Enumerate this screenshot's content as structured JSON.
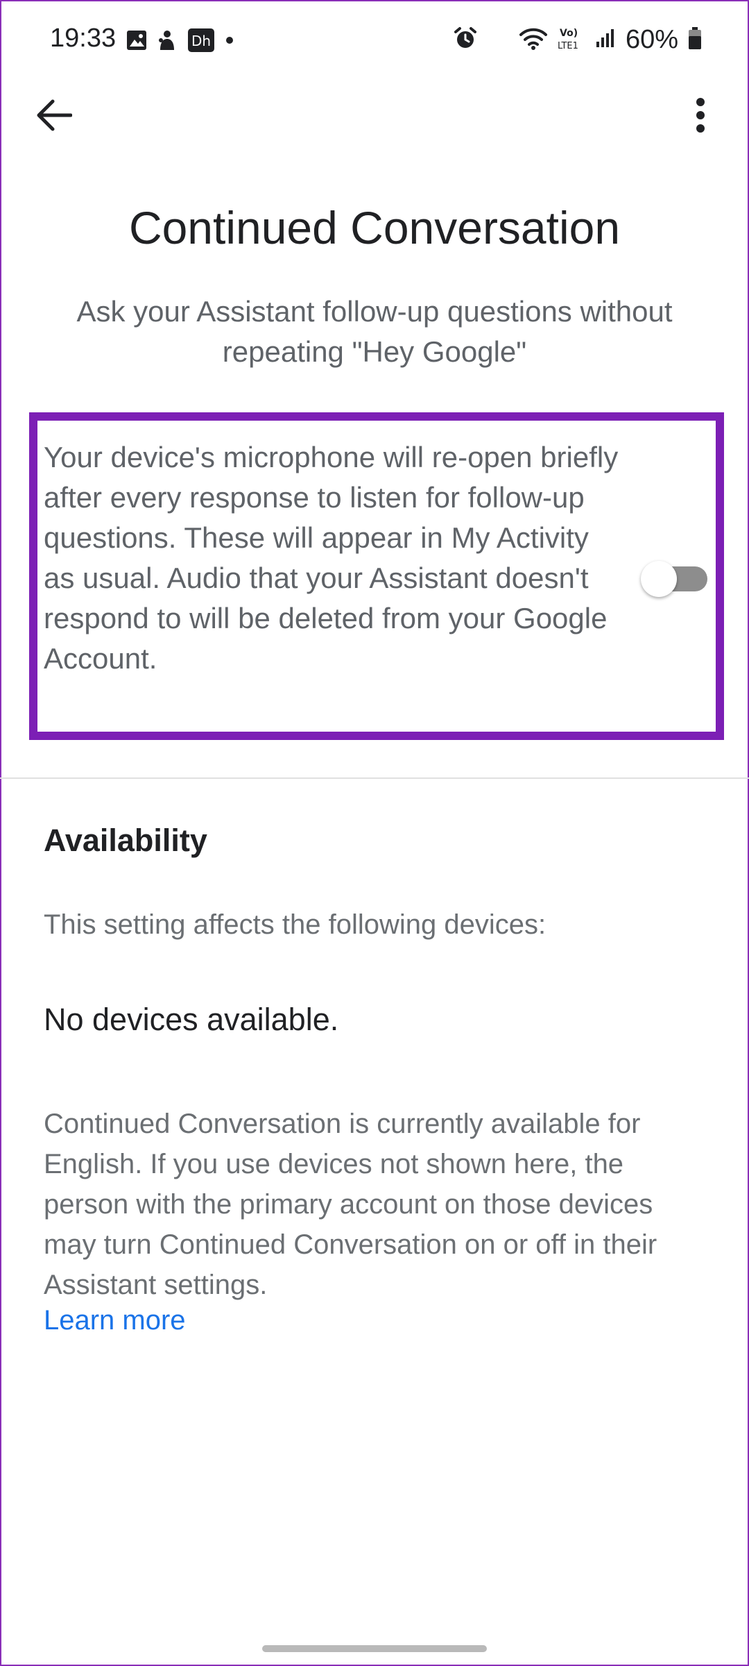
{
  "status_bar": {
    "time": "19:33",
    "battery_percent": "60%",
    "left_icons": [
      "gallery-icon",
      "teams-icon",
      "disney-hotstar-icon",
      "dot-icon"
    ],
    "right_icons": [
      "alarm-icon",
      "wifi-icon",
      "volte-lte-icon",
      "signal-icon",
      "battery-icon"
    ],
    "volte_label": "Vo)",
    "lte_label": "LTE1"
  },
  "app_bar": {
    "back_icon": "arrow-back-icon",
    "more_icon": "more-vert-icon"
  },
  "header": {
    "title": "Continued Conversation",
    "subtitle": "Ask your Assistant follow-up questions without repeating \"Hey Google\""
  },
  "setting": {
    "description": "Your device's microphone will re-open briefly after every response to listen for follow-up questions. These will appear in My Activity as usual. Audio that your Assistant doesn't respond to will be deleted from your Google Account.",
    "toggle_on": false
  },
  "availability": {
    "heading": "Availability",
    "caption": "This setting affects the following devices:",
    "no_devices": "No devices available.",
    "info": "Continued Conversation is currently available for English. If you use devices not shown here, the person with the primary account on those devices may turn Continued Conversation on or off in their Assistant settings.",
    "learn_more": "Learn more"
  },
  "colors": {
    "highlight_border": "#7c1fb5",
    "link": "#1a73e8",
    "toggle_track_off": "#8d8d8d",
    "text_secondary": "#5f6368"
  }
}
